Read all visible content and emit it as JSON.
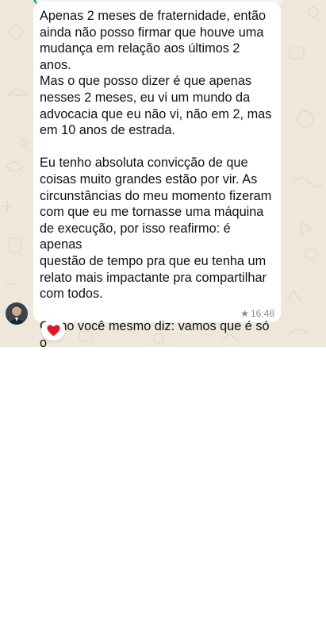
{
  "message": {
    "text": "Apenas 2 meses de fraternidade, então\nainda não posso firmar que houve uma\nmudança em relação aos últimos 2 anos.\nMas o que posso dizer é que apenas\nnesses 2 meses, eu vi um mundo da\nadvocacia que eu não vi, não em 2, mas\nem 10 anos de estrada.\n\nEu tenho absoluta convicção de que\ncoisas muito grandes estão por vir. As\ncircunstâncias do meu momento fizeram\ncom que eu me tornasse uma máquina\nde execução, por isso reafirmo: é apenas\nquestão de tempo pra que eu tenha um\nrelato mais impactante pra compartilhar\ncom todos.\n\nComo você mesmo diz: vamos que é só o\ncomeço.",
    "time": "16:48",
    "starred_icon": "star-icon",
    "reaction": "heart",
    "reaction_color": "#e0142a"
  },
  "colors": {
    "chat_background": "#efe7dc",
    "bubble": "#ffffff",
    "quote_accent": "#25a366"
  }
}
